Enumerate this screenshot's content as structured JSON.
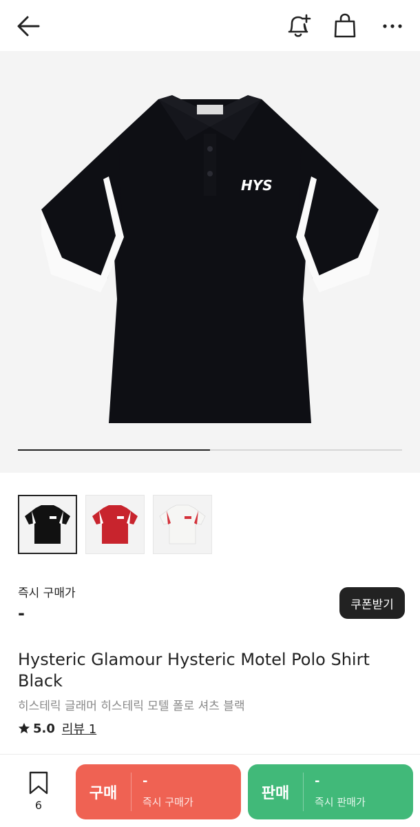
{
  "header": {
    "back_icon": "arrow-left-icon",
    "bell_icon": "bell-plus-icon",
    "bag_icon": "shopping-bag-icon",
    "more_icon": "more-horizontal-icon"
  },
  "gallery": {
    "progress": 0.5,
    "thumbnails": [
      {
        "color": "black",
        "selected": true
      },
      {
        "color": "red",
        "selected": false
      },
      {
        "color": "white",
        "selected": false
      }
    ],
    "logo_text": "HYS"
  },
  "price": {
    "label": "즉시 구매가",
    "value": "-",
    "coupon_label": "쿠폰받기"
  },
  "product": {
    "title": "Hysteric Glamour Hysteric Motel Polo Shirt Black",
    "subtitle": "히스테릭 글래머 히스테릭 모텔 폴로 셔츠 블랙",
    "rating": "5.0",
    "review_label": "리뷰 1"
  },
  "bottom": {
    "bookmark_count": "6",
    "buy": {
      "label": "구매",
      "price": "-",
      "sub": "즉시 구매가"
    },
    "sell": {
      "label": "판매",
      "price": "-",
      "sub": "즉시 판매가"
    }
  },
  "colors": {
    "buy": "#ef6253",
    "sell": "#41b979",
    "dark": "#222222"
  }
}
